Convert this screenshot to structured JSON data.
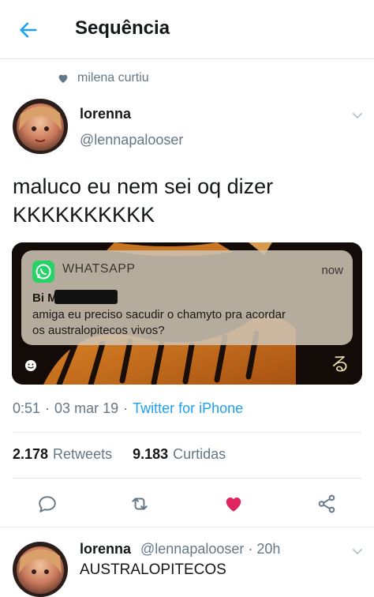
{
  "header": {
    "title": "Sequência"
  },
  "social_context": {
    "text": "milena curtiu"
  },
  "tweet": {
    "author_name": "lorenna",
    "author_handle": "@lennapalooser",
    "text_line1": "maluco eu nem sei oq dizer",
    "text_line2": "KKKKKKKKKK",
    "meta": {
      "time": "0:51",
      "date": "03 mar 19",
      "source": "Twitter for iPhone"
    },
    "stats": {
      "retweets": "2.178",
      "retweets_label": "Retweets",
      "likes": "9.183",
      "likes_label": "Curtidas"
    }
  },
  "media": {
    "app": "WHATSAPP",
    "time": "now",
    "sender": "Bi M",
    "message_line1": "amiga eu preciso sacudir o chamyto pra acordar",
    "message_line2": "os australopitecos vivos?",
    "corner_glyph": "る"
  },
  "reply": {
    "author_name": "lorenna",
    "author_handle": "@lennapalooser · 20h",
    "text": "AUSTRALOPITECOS"
  },
  "colors": {
    "accent": "#1da1f2",
    "like": "#e0245e",
    "muted": "#657786",
    "whatsapp": "#25d366"
  },
  "icons": [
    "back-arrow-icon",
    "heart-icon",
    "chevron-down-icon",
    "reply-icon",
    "retweet-icon",
    "like-icon",
    "share-icon",
    "whatsapp-icon",
    "smile-icon"
  ]
}
